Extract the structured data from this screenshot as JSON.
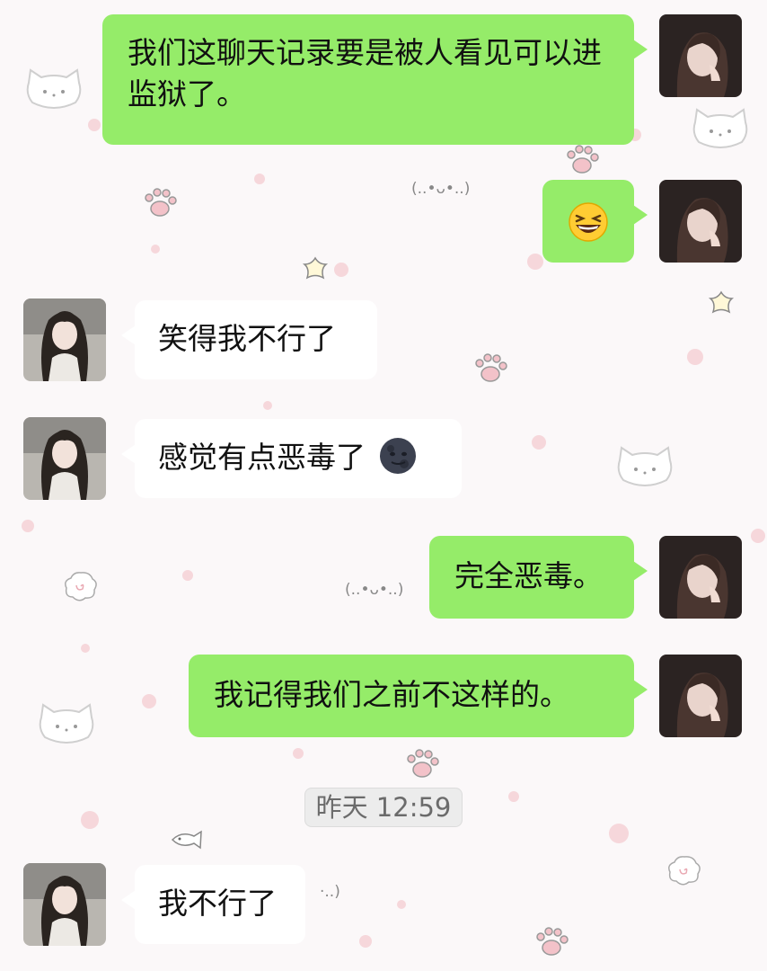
{
  "chat": {
    "messages": [
      {
        "side": "out",
        "text": "我们这聊天记录要是被人看见可以进监狱了。"
      },
      {
        "side": "out",
        "emoji": "grinning-squint-face-emoji"
      },
      {
        "side": "in",
        "text": "笑得我不行了"
      },
      {
        "side": "in",
        "text": "感觉有点恶毒了",
        "emoji": "new-moon-face-emoji"
      },
      {
        "side": "out",
        "text": "完全恶毒。"
      },
      {
        "side": "out",
        "text": "我记得我们之前不这样的。"
      },
      {
        "side": "in",
        "text": "我不行了"
      }
    ],
    "timestamp": "昨天 12:59"
  },
  "colors": {
    "outgoing_bubble": "#95ec69",
    "incoming_bubble": "#ffffff",
    "background": "#fbf8f9"
  },
  "decor": {
    "emoticon_1": "(..•ᴗ•..)",
    "emoticon_2": "(..•ᴗ•..)",
    "emoticon_3": "·..)"
  }
}
